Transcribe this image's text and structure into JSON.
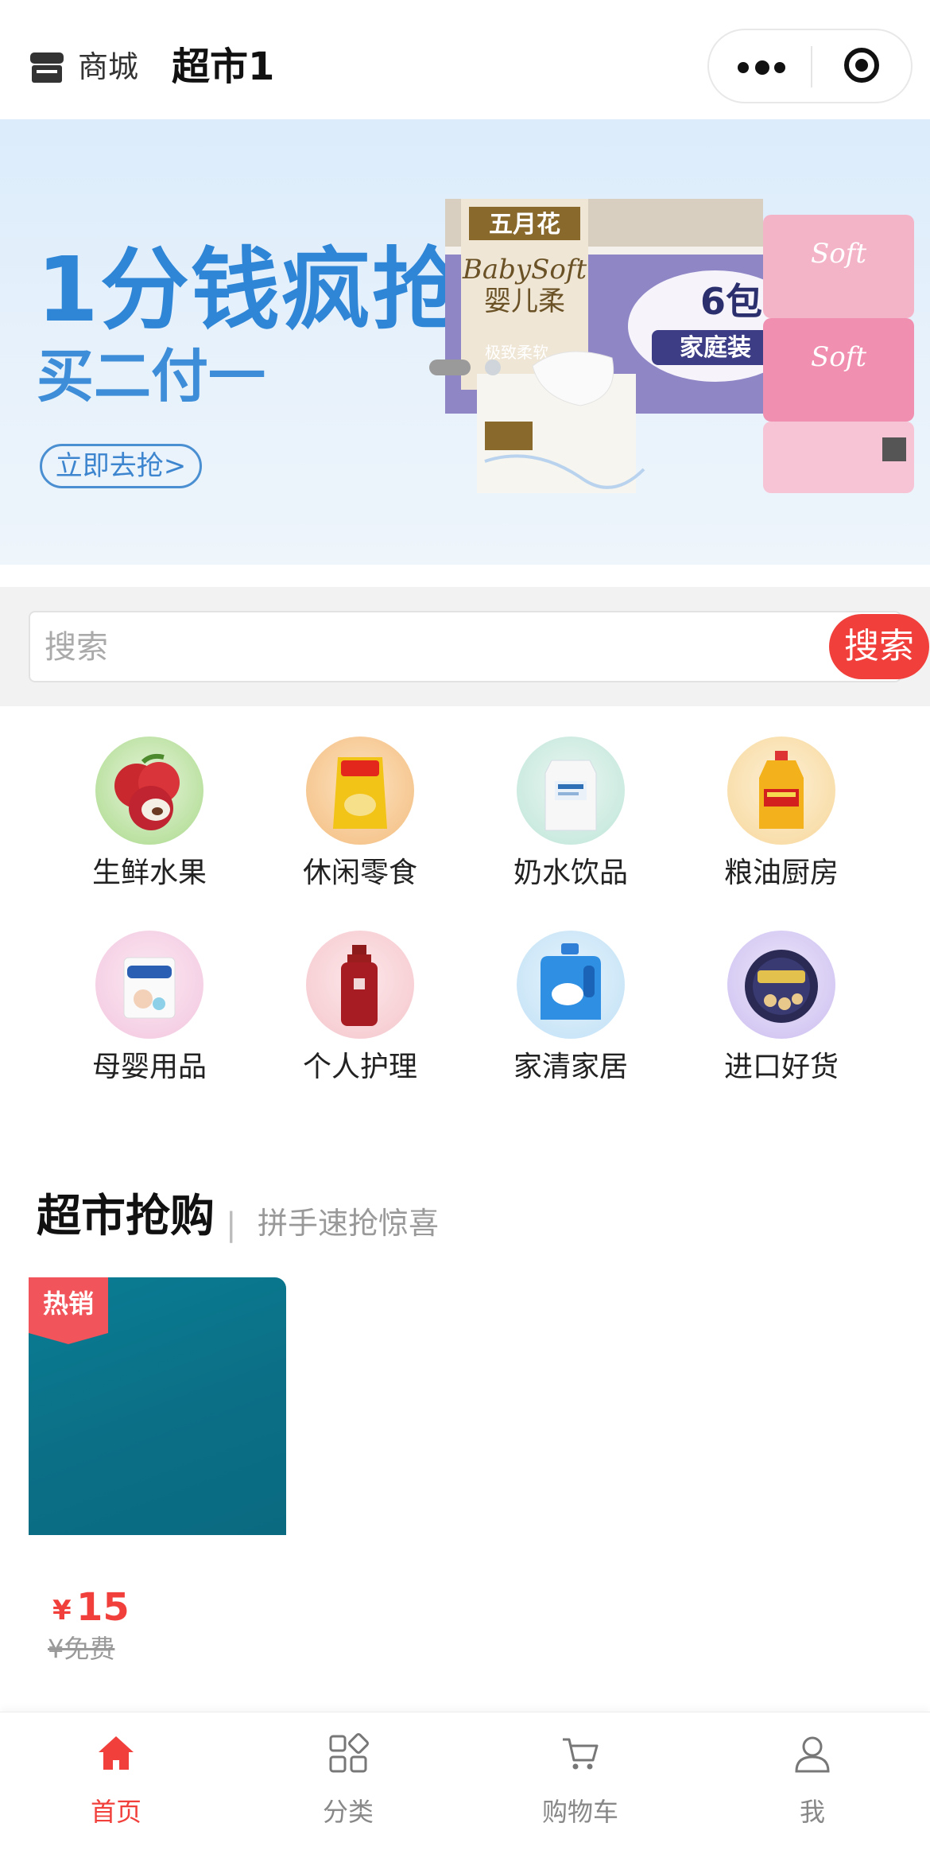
{
  "header": {
    "shop_label": "商城",
    "title": "超市1",
    "shop_icon": "shop-icon",
    "more_icon": "more-dots-icon",
    "close_icon": "target-icon"
  },
  "banner": {
    "headline": "1分钱疯抢",
    "subline": "买二付一",
    "cta_label": "立即去抢>",
    "slide_count": 2,
    "active_slide": 0,
    "product_text": {
      "brand": "五月花",
      "series": "BabySoft",
      "series_cn": "婴儿柔",
      "feature": "极致柔软",
      "pack": "6包",
      "pack_type": "家庭装",
      "pink_brand": "Soft"
    }
  },
  "search": {
    "placeholder": "搜索",
    "button_label": "搜索"
  },
  "categories": [
    {
      "label": "生鲜水果",
      "icon": "lychee-icon"
    },
    {
      "label": "休闲零食",
      "icon": "chips-icon"
    },
    {
      "label": "奶水饮品",
      "icon": "milk-icon"
    },
    {
      "label": "粮油厨房",
      "icon": "oil-bottle-icon"
    },
    {
      "label": "母婴用品",
      "icon": "diaper-icon"
    },
    {
      "label": "个人护理",
      "icon": "shampoo-icon"
    },
    {
      "label": "家清家居",
      "icon": "detergent-icon"
    },
    {
      "label": "进口好货",
      "icon": "cookie-tin-icon"
    }
  ],
  "section": {
    "title": "超市抢购",
    "separator": "|",
    "subtitle": "拼手速抢惊喜"
  },
  "product": {
    "badge": "热销",
    "currency": "¥",
    "price": "15",
    "old_price": "¥免费"
  },
  "tabbar": [
    {
      "label": "首页",
      "icon": "home-icon",
      "active": true
    },
    {
      "label": "分类",
      "icon": "category-grid-icon",
      "active": false
    },
    {
      "label": "购物车",
      "icon": "cart-icon",
      "active": false
    },
    {
      "label": "我",
      "icon": "user-icon",
      "active": false
    }
  ],
  "colors": {
    "accent": "#f1403c",
    "banner_blue": "#2f86d6",
    "product_teal": "#0a7d94"
  }
}
